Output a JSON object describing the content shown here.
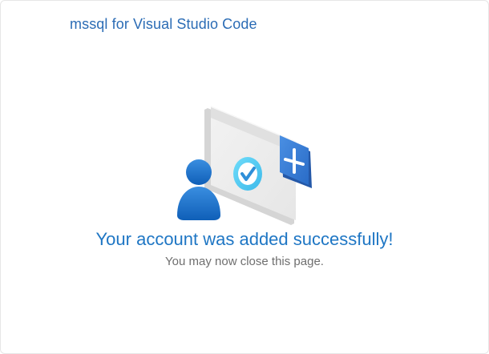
{
  "app": {
    "title": "mssql for Visual Studio Code"
  },
  "message": {
    "headline": "Your account was added successfully!",
    "subtext": "You may now close this page."
  },
  "illustration": {
    "icons": [
      "user-icon",
      "browser-window-icon",
      "checkmark-icon",
      "plus-icon"
    ],
    "colors": {
      "accent": "#1e76c4",
      "window": "#ececec",
      "check": "#5ccff2",
      "plus_tile": "#3b7fd6"
    }
  }
}
